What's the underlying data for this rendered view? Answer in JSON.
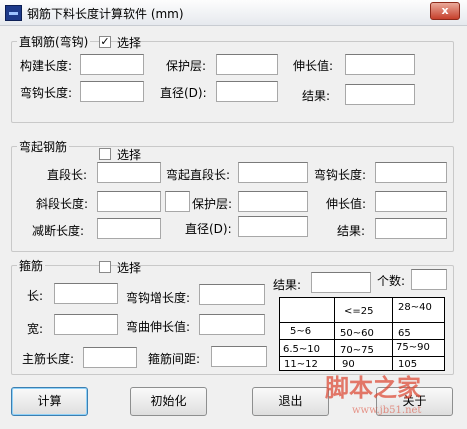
{
  "window": {
    "title": "钢筋下料长度计算软件   (mm)",
    "close_label": "x"
  },
  "straight": {
    "group_label": "直钢筋(弯钩)",
    "check_mark": "✓",
    "check_label": "选择",
    "label_construct_length": "构建长度:",
    "label_cover": "保护层:",
    "label_elongation": "伸长值:",
    "label_hook_length": "弯钩长度:",
    "label_diameter": "直径(D):",
    "label_result": "结果:"
  },
  "bent": {
    "group_label": "弯起钢筋",
    "check_label": "选择",
    "label_straight_length": "直段长:",
    "label_bent_straight_length": "弯起直段长:",
    "label_hook_length": "弯钩长度:",
    "label_slope_length": "斜段长度:",
    "label_cover": "保护层:",
    "label_elongation": "伸长值:",
    "label_cut_length": "减断长度:",
    "label_diameter": "直径(D):",
    "label_result": "结果:"
  },
  "stirrup": {
    "group_label": "箍筋",
    "check_label": "选择",
    "label_length": "长:",
    "label_hook_increment": "弯钩增长度:",
    "label_result": "结果:",
    "label_count": "个数:",
    "label_width": "宽:",
    "label_bend_elongation": "弯曲伸长值:",
    "label_main_bar_length": "主筋长度:",
    "label_spacing": "箍筋间距:",
    "table": {
      "header": [
        "",
        "<=25",
        "28~40"
      ],
      "rows": [
        [
          "5~6",
          "50~60",
          "65"
        ],
        [
          "6.5~10",
          "70~75",
          "75~90"
        ],
        [
          "11~12",
          "90",
          "105"
        ]
      ]
    }
  },
  "buttons": {
    "calculate": "计算",
    "initialize": "初始化",
    "exit": "退出",
    "about": "关于"
  },
  "watermark": {
    "text": "脚本之家",
    "url": "www.jb51.net"
  }
}
